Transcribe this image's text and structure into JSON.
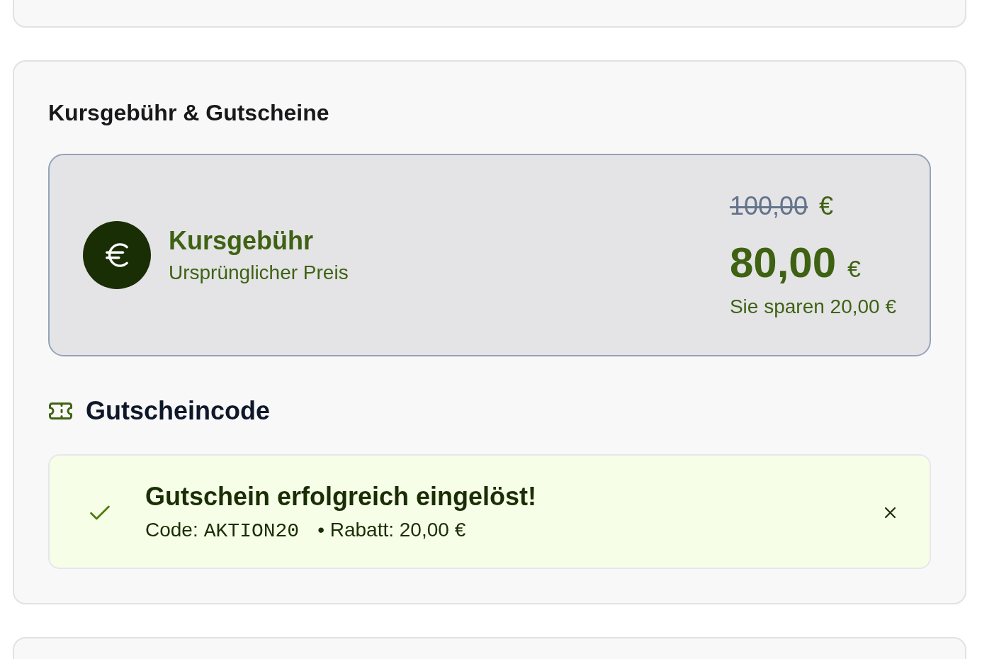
{
  "fee_section": {
    "title": "Kursgebühr & Gutscheine",
    "price_card": {
      "title": "Kursgebühr",
      "subtitle": "Ursprünglicher Preis",
      "original": {
        "amount": "100,00",
        "currency": "€",
        "struck": true
      },
      "final": {
        "amount": "80,00",
        "currency": "€"
      },
      "savings": "Sie sparen 20,00 €"
    },
    "voucher": {
      "heading": "Gutscheincode",
      "alert": {
        "kind": "success",
        "title": "Gutschein erfolgreich eingelöst!",
        "code_label": "Code:",
        "code": "AKTION20",
        "discount": "• Rabatt: 20,00 €",
        "dismissible": true
      }
    }
  }
}
